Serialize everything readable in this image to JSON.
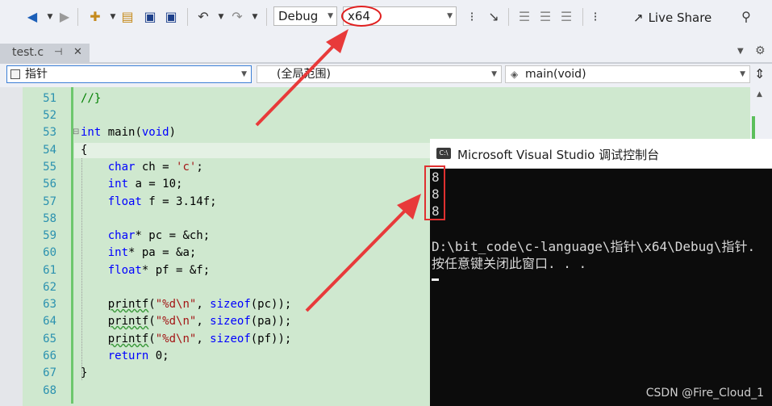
{
  "toolbar": {
    "config": "Debug",
    "platform": "x64",
    "live_share": "Live Share"
  },
  "tab": {
    "filename": "test.c",
    "pin_glyph": "⊣",
    "close_glyph": "✕"
  },
  "navbar": {
    "scope_project": "指针",
    "scope_global": "(全局范围)",
    "scope_function": "main(void)"
  },
  "editor": {
    "lines": [
      {
        "n": "51",
        "text": "//}"
      },
      {
        "n": "52",
        "text": ""
      },
      {
        "n": "53",
        "text": "int main(void)"
      },
      {
        "n": "54",
        "text": "{"
      },
      {
        "n": "55",
        "text": "    char ch = 'c';"
      },
      {
        "n": "56",
        "text": "    int a = 10;"
      },
      {
        "n": "57",
        "text": "    float f = 3.14f;"
      },
      {
        "n": "58",
        "text": ""
      },
      {
        "n": "59",
        "text": "    char* pc = &ch;"
      },
      {
        "n": "60",
        "text": "    int* pa = &a;"
      },
      {
        "n": "61",
        "text": "    float* pf = &f;"
      },
      {
        "n": "62",
        "text": ""
      },
      {
        "n": "63",
        "text": "    printf(\"%d\\n\", sizeof(pc));"
      },
      {
        "n": "64",
        "text": "    printf(\"%d\\n\", sizeof(pa));"
      },
      {
        "n": "65",
        "text": "    printf(\"%d\\n\", sizeof(pf));"
      },
      {
        "n": "66",
        "text": "    return 0;"
      },
      {
        "n": "67",
        "text": "}"
      },
      {
        "n": "68",
        "text": ""
      }
    ]
  },
  "console": {
    "title": "Microsoft Visual Studio 调试控制台",
    "icon_text": "C:\\",
    "output": [
      "8",
      "8",
      "8",
      "",
      "D:\\bit_code\\c-language\\指针\\x64\\Debug\\指针.",
      "按任意键关闭此窗口. . ."
    ]
  },
  "watermark": "CSDN @Fire_Cloud_1",
  "colors": {
    "editor_bg": "#cfe8cf",
    "keyword": "#0000ff",
    "string": "#a31515",
    "line_number": "#2b91af",
    "annotation_red": "#e03030",
    "console_bg": "#0c0c0c"
  }
}
